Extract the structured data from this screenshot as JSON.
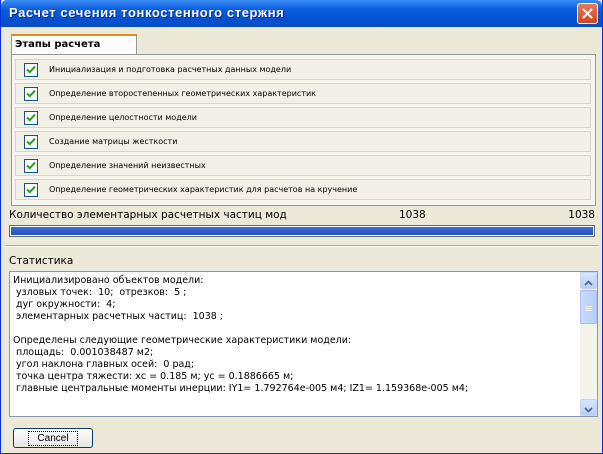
{
  "window": {
    "title": "Расчет сечения тонкостенного стержня"
  },
  "tabs": [
    {
      "label": "Этапы расчета",
      "active": true
    }
  ],
  "steps": [
    {
      "label": "Инициализация и подготовка расчетных данных модели",
      "checked": true
    },
    {
      "label": "Определение второстепенных геометрических характеристик",
      "checked": true
    },
    {
      "label": "Определение целостности модели",
      "checked": true
    },
    {
      "label": "Создание матрицы жесткости",
      "checked": true
    },
    {
      "label": "Определение значений неизвестных",
      "checked": true
    },
    {
      "label": "Определение геометрических характеристик для расчетов на кручение",
      "checked": true
    }
  ],
  "progress": {
    "label": "Количество элементарных расчетных частиц мод",
    "value": "1038",
    "total": "1038",
    "fraction": 1.0
  },
  "statistics": {
    "label": "Статистика",
    "text": "Инициализировано объектов модели:\n узловых точек:  10;  отрезков:  5 ;\n дуг окружности:  4;\n элементарных расчетных частиц:  1038 ;\n\nОпределены следующие геометрические характеристики модели:\n площадь:  0.001038487 м2;\n угол наклона главных осей:  0 рад;\n точка центра тяжести: хс = 0.185 м; ус = 0.1886665 м;\n главные центральные моменты инерции: IY1= 1.792764e-005 м4; IZ1= 1.159368e-005 м4;"
  },
  "buttons": {
    "cancel": "Cancel"
  },
  "colors": {
    "titlebar": "#0453D4",
    "progress": "#2154B8",
    "check": "#21A121",
    "close": "#D5431E"
  },
  "icons": {
    "close": "close-icon",
    "check": "checkmark-icon",
    "scroll_up": "scroll-up-arrow-icon",
    "scroll_down": "scroll-down-arrow-icon"
  }
}
